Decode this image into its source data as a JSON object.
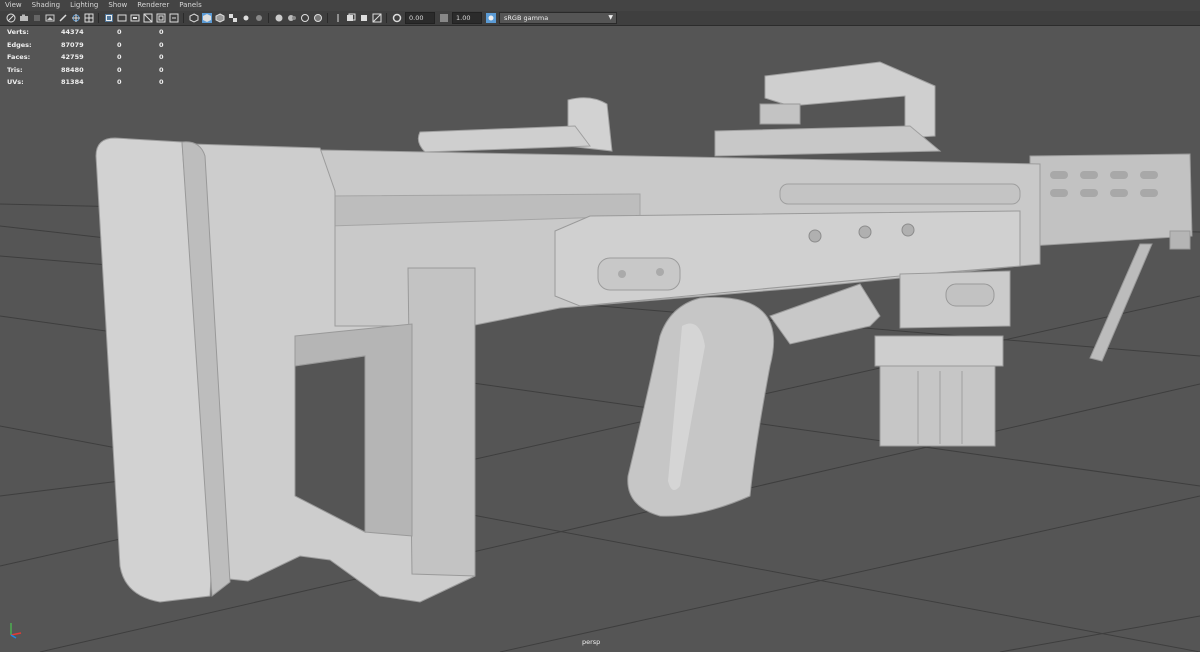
{
  "menu": [
    "View",
    "Shading",
    "Lighting",
    "Show",
    "Renderer",
    "Panels"
  ],
  "toolbar": {
    "exposure_value": "0.00",
    "gamma_value": "1.00",
    "color_space": "sRGB gamma",
    "icons": [
      "camera-select-icon",
      "camera-attrs-icon",
      "bookmark-icon",
      "image-plane-icon",
      "grease-pencil-icon",
      "2d-pan-zoom-icon",
      "grid-icon",
      "film-gate-icon",
      "resolution-gate-icon",
      "gate-mask-icon",
      "field-chart-icon",
      "safe-action-icon",
      "safe-title-icon",
      "wireframe-icon",
      "smooth-shade-icon",
      "default-material-icon",
      "textured-icon",
      "use-all-lights-icon",
      "shadows-icon",
      "screen-space-ao-icon",
      "motion-blur-icon",
      "multisample-aa-icon",
      "depth-of-field-icon",
      "isolate-select-icon",
      "xray-icon",
      "xray-active-icon",
      "xray-joints-icon",
      "exposure-icon",
      "gamma-icon",
      "color-management-icon"
    ]
  },
  "hud": {
    "rows": [
      {
        "label": "Verts:",
        "value": "44374",
        "c1": "0",
        "c2": "0"
      },
      {
        "label": "Edges:",
        "value": "87079",
        "c1": "0",
        "c2": "0"
      },
      {
        "label": "Faces:",
        "value": "42759",
        "c1": "0",
        "c2": "0"
      },
      {
        "label": "Tris:",
        "value": "88480",
        "c1": "0",
        "c2": "0"
      },
      {
        "label": "UVs:",
        "value": "81384",
        "c1": "0",
        "c2": "0"
      }
    ]
  },
  "camera_label": "persp",
  "colors": {
    "viewport_bg": "#555555",
    "model": "#c8c8c8",
    "grid": "#3d3d3d",
    "accent": "#5b9bd5"
  }
}
